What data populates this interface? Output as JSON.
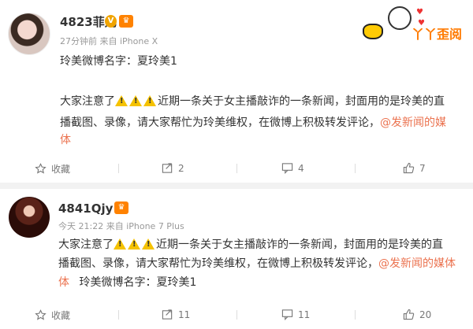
{
  "posts": [
    {
      "username": "4823菲儿",
      "meta": "27分钟前  来自 iPhone X",
      "line1": "玲美微博名字：夏玲美1",
      "body_prefix": "大家注意了",
      "body_main": "近期一条关于女主播敲诈的一条新闻，封面用的是玲美的直",
      "body_line2_prefix": "播截图、录像，请大家帮忙为玲美维权，在微博上积极转发评论，",
      "mention_part1": "@发新闻的媒",
      "mention_part2": "体",
      "actions": {
        "favorite": "收藏",
        "repost": "2",
        "comment": "4",
        "like": "7"
      }
    },
    {
      "username": "4841Qjy丶",
      "meta": "今天 21:22 来自 iPhone 7 Plus",
      "body_prefix": "大家注意了",
      "body_main": "近期一条关于女主播敲诈的一条新闻，封面用的是玲美的直",
      "body_line2_prefix": "播截图、录像，请大家帮忙为玲美维权，在微博上积极转发评论，",
      "mention_part1": "@发新闻的媒体",
      "mention_part2": "体",
      "trailing": "玲美微博名字：夏玲美1",
      "actions": {
        "favorite": "收藏",
        "repost": "11",
        "comment": "11",
        "like": "20"
      }
    }
  ],
  "watermark": {
    "text": "丫丫歪阅"
  },
  "icons": {
    "favorite": "star-icon",
    "repost": "repost-icon",
    "comment": "comment-icon",
    "like": "thumbs-up-icon",
    "warning": "warning-icon",
    "verified": "verified-v-icon",
    "vip": "vip-crown-icon"
  },
  "colors": {
    "link": "#eb7350",
    "warning": "#f5c200",
    "meta": "#999999",
    "gap": "#f2f2f2"
  }
}
